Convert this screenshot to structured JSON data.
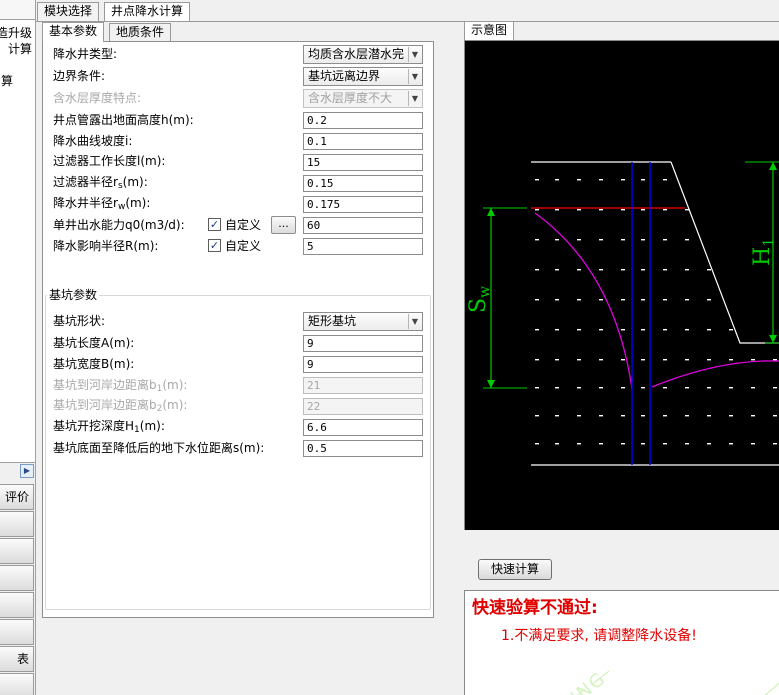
{
  "module_tabs": [
    "模块选择",
    "井点降水计算"
  ],
  "left_strip": {
    "cut_texts": [
      "改造升级",
      "计算",
      "算"
    ],
    "side_buttons": [
      "评价",
      "",
      "",
      "",
      "",
      "",
      "",
      "表",
      ""
    ]
  },
  "param_tabs": [
    "基本参数",
    "地质条件"
  ],
  "basic": {
    "well_type": {
      "label": "降水井类型:",
      "value": "均质含水层潜水完"
    },
    "boundary": {
      "label": "边界条件:",
      "value": "基坑远离边界"
    },
    "aquifer": {
      "label": "含水层厚度特点:",
      "value": "含水层厚度不大"
    },
    "h": {
      "label_pre": "井点管露出地面高度h(m):",
      "value": "0.2"
    },
    "i": {
      "label": "降水曲线坡度i:",
      "value": "0.1"
    },
    "l": {
      "label": "过滤器工作长度l(m):",
      "value": "15"
    },
    "rs": {
      "label_pre": "过滤器半径r",
      "label_sub": "s",
      "label_post": "(m):",
      "value": "0.15"
    },
    "rw": {
      "label_pre": "降水井半径r",
      "label_sub": "w",
      "label_post": "(m):",
      "value": "0.175"
    },
    "q0": {
      "label": "单井出水能力q0(m3/d):",
      "custom": "自定义",
      "dots": "...",
      "value": "60"
    },
    "R": {
      "label": "降水影响半径R(m):",
      "custom": "自定义",
      "value": "5"
    }
  },
  "pit": {
    "group_title": "基坑参数",
    "shape": {
      "label": "基坑形状:",
      "value": "矩形基坑"
    },
    "A": {
      "label": "基坑长度A(m):",
      "value": "9"
    },
    "B": {
      "label": "基坑宽度B(m):",
      "value": "9"
    },
    "b1": {
      "label_pre": "基坑到河岸边距离b",
      "label_sub": "1",
      "label_post": "(m):",
      "value": "21"
    },
    "b2": {
      "label_pre": "基坑到河岸边距离b",
      "label_sub": "2",
      "label_post": "(m):",
      "value": "22"
    },
    "H1": {
      "label_pre": "基坑开挖深度H",
      "label_sub": "1",
      "label_post": "(m):",
      "value": "6.6"
    },
    "s": {
      "label": "基坑底面至降低后的地下水位距离s(m):",
      "value": "0.5"
    }
  },
  "diagram": {
    "tab": "示意图",
    "sw_label": "S",
    "sw_sub": "w",
    "h1_label": "H",
    "h1_sub": "1",
    "colors": {
      "background": "#000000",
      "ground": "#ffffff",
      "water": "#ff0000",
      "curve": "#e000e0",
      "well": "#0000ff",
      "dimension": "#00cc00"
    }
  },
  "calc": {
    "button": "快速计算",
    "result_title": "快速验算不通过:",
    "result_line": "1.不满足要求, 请调整降水设备!"
  }
}
